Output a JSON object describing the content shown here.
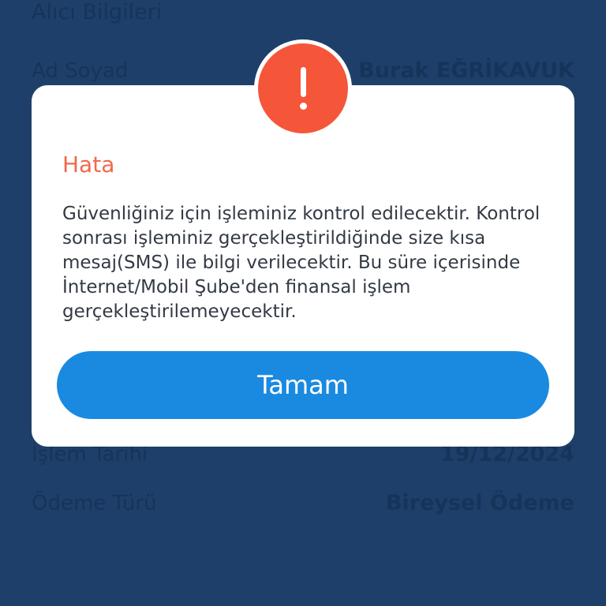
{
  "background": {
    "section_title": "Alıcı Bilgileri",
    "rows": [
      {
        "label": "Ad Soyad",
        "value": "Burak EĞRİKAVUK"
      },
      {
        "label": "İşlem Tarihi",
        "value": "19/12/2024"
      },
      {
        "label": "Ödeme Türü",
        "value": "Bireysel Ödeme"
      }
    ]
  },
  "dialog": {
    "icon": "exclamation-icon",
    "title": "Hata",
    "message": "Güvenliğiniz için işleminiz kontrol edilecektir. Kontrol sonrası işleminiz gerçekleştirildiğinde size kısa mesaj(SMS) ile bilgi verilecektir. Bu süre içerisinde İnternet/Mobil Şube'den finansal işlem gerçekleştirilemeyecektir.",
    "button_label": "Tamam"
  },
  "colors": {
    "background": "#1e3f69",
    "alert": "#f5563a",
    "title": "#f06a4a",
    "button": "#1a8ae0"
  }
}
